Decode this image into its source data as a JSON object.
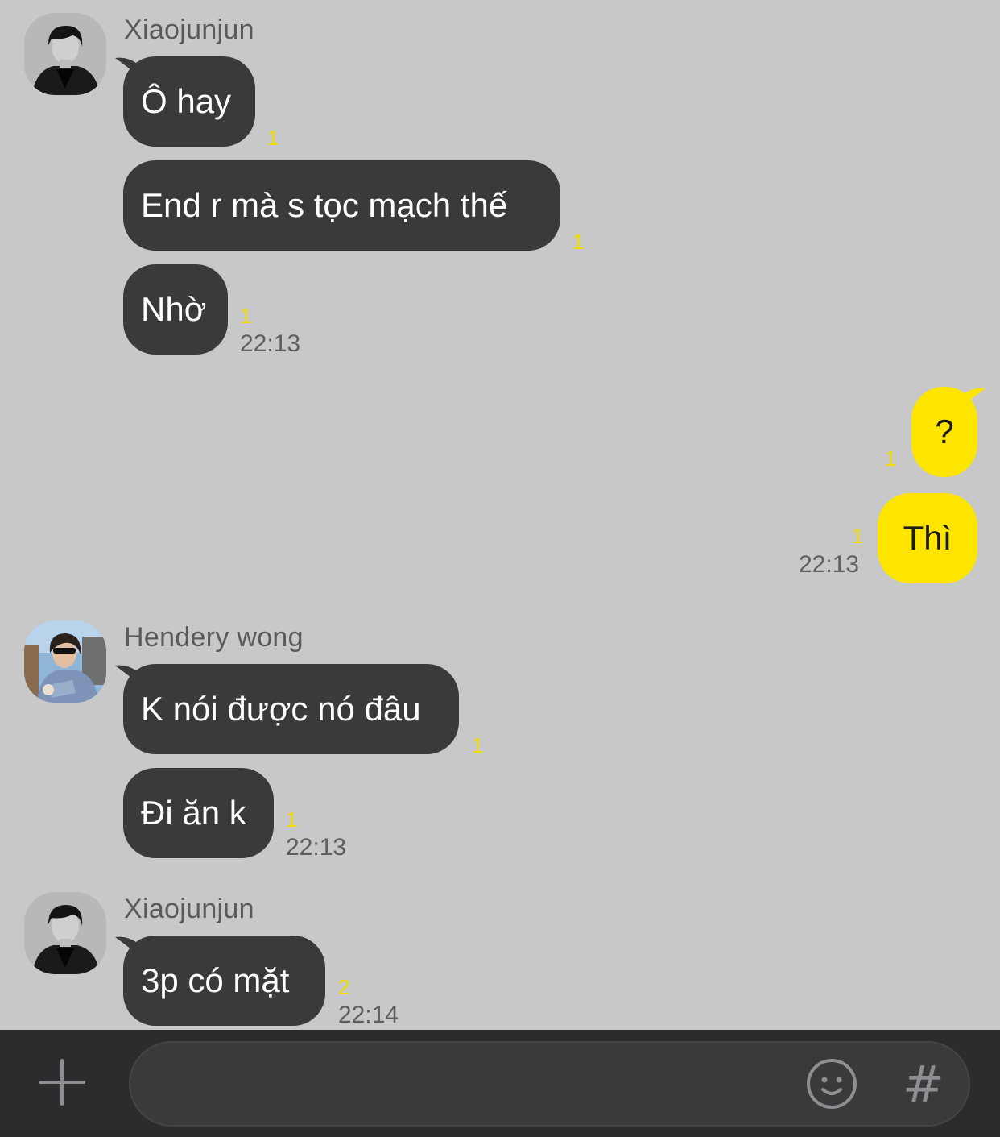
{
  "messages": {
    "group1": {
      "sender": "Xiaojunjun",
      "bubbles": [
        {
          "text": "Ô hay",
          "unread": "1"
        },
        {
          "text": "End r mà s tọc mạch thế",
          "unread": "1"
        },
        {
          "text": "Nhờ",
          "unread": "1"
        }
      ],
      "time": "22:13"
    },
    "group2": {
      "bubbles": [
        {
          "text": "?",
          "unread": "1"
        },
        {
          "text": "Thì",
          "unread": "1"
        }
      ],
      "time": "22:13"
    },
    "group3": {
      "sender": "Hendery wong",
      "bubbles": [
        {
          "text": "K nói được nó đâu",
          "unread": "1"
        },
        {
          "text": "Đi ăn k",
          "unread": "1"
        }
      ],
      "time": "22:13"
    },
    "group4": {
      "sender": "Xiaojunjun",
      "bubbles": [
        {
          "text": "3p có mặt",
          "unread": "2"
        }
      ],
      "time": "22:14"
    }
  },
  "composer": {
    "placeholder": "",
    "plus_icon": "plus-icon",
    "emoji_icon": "smiley-icon",
    "hash_symbol": "#"
  },
  "colors": {
    "background": "#c8c8c8",
    "incoming_bubble": "#3a3a3c",
    "outgoing_bubble": "#fde500",
    "unread_count": "#f2de00",
    "composer_bar": "#2c2c2e"
  }
}
